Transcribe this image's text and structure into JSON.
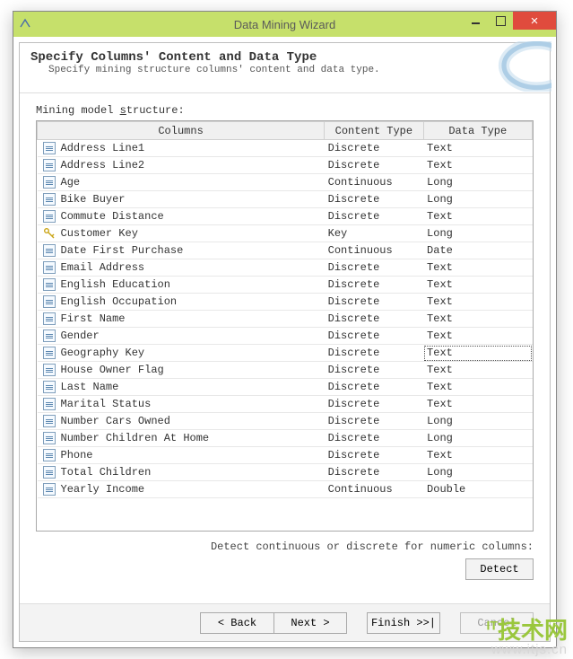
{
  "window": {
    "title": "Data Mining Wizard"
  },
  "header": {
    "title": "Specify Columns' Content and Data Type",
    "subtitle": "Specify mining structure columns' content and data type."
  },
  "section_label": {
    "prefix": "Mining model ",
    "underlined": "s",
    "suffix": "tructure:"
  },
  "grid": {
    "headers": {
      "col1": "Columns",
      "col2": "Content Type",
      "col3": "Data Type"
    },
    "rows": [
      {
        "name": "Address Line1",
        "content": "Discrete",
        "dtype": "Text",
        "key": false
      },
      {
        "name": "Address Line2",
        "content": "Discrete",
        "dtype": "Text",
        "key": false
      },
      {
        "name": "Age",
        "content": "Continuous",
        "dtype": "Long",
        "key": false
      },
      {
        "name": "Bike Buyer",
        "content": "Discrete",
        "dtype": "Long",
        "key": false
      },
      {
        "name": "Commute Distance",
        "content": "Discrete",
        "dtype": "Text",
        "key": false
      },
      {
        "name": "Customer Key",
        "content": "Key",
        "dtype": "Long",
        "key": true
      },
      {
        "name": "Date First Purchase",
        "content": "Continuous",
        "dtype": "Date",
        "key": false
      },
      {
        "name": "Email Address",
        "content": "Discrete",
        "dtype": "Text",
        "key": false
      },
      {
        "name": "English Education",
        "content": "Discrete",
        "dtype": "Text",
        "key": false
      },
      {
        "name": "English Occupation",
        "content": "Discrete",
        "dtype": "Text",
        "key": false
      },
      {
        "name": "First Name",
        "content": "Discrete",
        "dtype": "Text",
        "key": false
      },
      {
        "name": "Gender",
        "content": "Discrete",
        "dtype": "Text",
        "key": false
      },
      {
        "name": "Geography Key",
        "content": "Discrete",
        "dtype": "Text",
        "key": false,
        "selected": true
      },
      {
        "name": "House Owner Flag",
        "content": "Discrete",
        "dtype": "Text",
        "key": false
      },
      {
        "name": "Last Name",
        "content": "Discrete",
        "dtype": "Text",
        "key": false
      },
      {
        "name": "Marital Status",
        "content": "Discrete",
        "dtype": "Text",
        "key": false
      },
      {
        "name": "Number Cars Owned",
        "content": "Discrete",
        "dtype": "Long",
        "key": false
      },
      {
        "name": "Number Children At Home",
        "content": "Discrete",
        "dtype": "Long",
        "key": false
      },
      {
        "name": "Phone",
        "content": "Discrete",
        "dtype": "Text",
        "key": false
      },
      {
        "name": "Total Children",
        "content": "Discrete",
        "dtype": "Long",
        "key": false
      },
      {
        "name": "Yearly Income",
        "content": "Continuous",
        "dtype": "Double",
        "key": false
      }
    ]
  },
  "detect": {
    "hint": "Detect continuous or discrete for numeric columns:",
    "button": "Detect",
    "button_underline": "D"
  },
  "footer": {
    "back": "< Back",
    "next": "Next >",
    "finish": "Finish >>|",
    "cancel": "Cancel"
  },
  "watermark": {
    "line1_prefix": "IT",
    "line1_suffix": "技术网",
    "line2": "www.itjs.cn"
  }
}
